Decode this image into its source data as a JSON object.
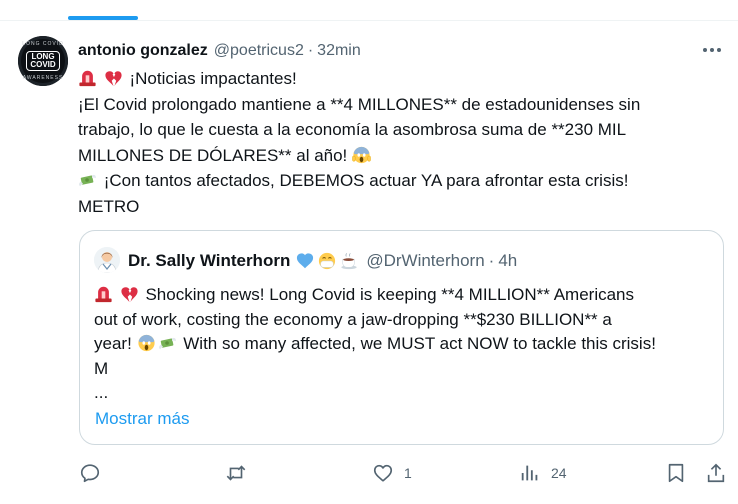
{
  "author": {
    "display_name": "antonio gonzalez",
    "handle": "@poetricus2",
    "separator": "·",
    "time": "32min",
    "avatar_ring_top": "LONG COVID",
    "avatar_badge_line1": "LONG",
    "avatar_badge_line2": "COVID",
    "avatar_ring_bottom": "AWARENESS"
  },
  "tweet": {
    "line1": "¡Noticias impactantes!",
    "line2": "¡El Covid prolongado mantiene a **4 MILLONES** de estadounidenses sin",
    "line3": "trabajo, lo que le cuesta a la economía la asombrosa suma de **230 MIL",
    "line4": "MILLONES DE DÓLARES** al año!",
    "line5": "¡Con tantos afectados, DEBEMOS actuar YA para afrontar esta crisis!",
    "line6": "METRO"
  },
  "quote": {
    "display_name": "Dr. Sally Winterhorn",
    "handle": "@DrWinterhorn",
    "separator": "·",
    "time": "4h",
    "line1": "Shocking news! Long Covid is keeping **4 MILLION** Americans",
    "line2": "out of work, costing the economy a jaw-dropping **$230 BILLION** a",
    "line3": "year!",
    "line3b": "With so many affected, we MUST act NOW to tackle this crisis!",
    "line4": "M",
    "line5": "...",
    "show_more": "Mostrar más"
  },
  "actions": {
    "likes": "1",
    "views": "24"
  },
  "colors": {
    "accent": "#1d9bf0",
    "text": "#0f1419",
    "secondary": "#536471",
    "border": "#cfd9de"
  },
  "icons": {
    "alarm": "rotating-light-icon",
    "heart": "broken-heart-icon",
    "scream": "screaming-face-icon",
    "money": "money-with-wings-icon"
  }
}
